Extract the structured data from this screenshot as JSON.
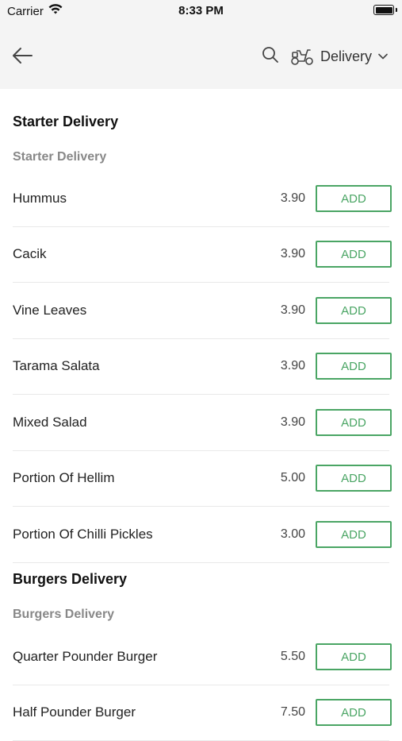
{
  "status_bar": {
    "carrier": "Carrier",
    "time": "8:33 PM"
  },
  "nav": {
    "back_icon": "arrow-left-icon",
    "search_icon": "search-icon",
    "mode_icon": "scooter-icon",
    "mode_label": "Delivery",
    "dropdown_icon": "chevron-down-icon"
  },
  "sections": [
    {
      "title": "Starter Delivery",
      "subtitle": "Starter Delivery",
      "items": [
        {
          "name": "Hummus",
          "price": "3.90",
          "button": "ADD"
        },
        {
          "name": "Cacik",
          "price": "3.90",
          "button": "ADD"
        },
        {
          "name": "Vine Leaves",
          "price": "3.90",
          "button": "ADD"
        },
        {
          "name": "Tarama Salata",
          "price": "3.90",
          "button": "ADD"
        },
        {
          "name": "Mixed Salad",
          "price": "3.90",
          "button": "ADD"
        },
        {
          "name": "Portion Of Hellim",
          "price": "5.00",
          "button": "ADD"
        },
        {
          "name": "Portion Of Chilli Pickles",
          "price": "3.00",
          "button": "ADD"
        }
      ]
    },
    {
      "title": "Burgers Delivery",
      "subtitle": "Burgers Delivery",
      "items": [
        {
          "name": "Quarter Pounder Burger",
          "price": "5.50",
          "button": "ADD"
        },
        {
          "name": "Half Pounder Burger",
          "price": "7.50",
          "button": "ADD"
        }
      ]
    }
  ],
  "colors": {
    "accent": "#4aa564",
    "header_bg": "#f4f4f4"
  }
}
